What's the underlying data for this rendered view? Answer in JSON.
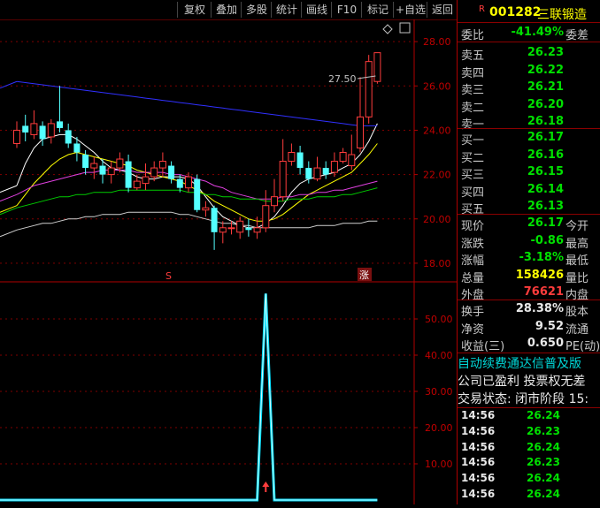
{
  "toolbar": {
    "buttons": [
      "复权",
      "叠加",
      "多股",
      "统计",
      "画线",
      "F10",
      "标记",
      "+自选",
      "返回"
    ]
  },
  "main_chart": {
    "y_ticks": [
      "28.00",
      "26.00",
      "24.00",
      "22.00",
      "20.00",
      "18.00"
    ],
    "high_label": "27.50",
    "marker_left": "S",
    "marker_right": "涨",
    "settings_icon": "diamond-icon"
  },
  "sub_chart": {
    "y_ticks": [
      "50.00",
      "40.00",
      "30.00",
      "20.00",
      "10.00"
    ]
  },
  "chart_data": {
    "type": "line",
    "candles": [
      [
        23.4,
        24.0,
        24.4,
        23.2
      ],
      [
        24.2,
        23.9,
        24.7,
        23.5
      ],
      [
        23.8,
        24.3,
        24.9,
        23.6
      ],
      [
        24.2,
        23.6,
        24.4,
        23.3
      ],
      [
        23.7,
        24.3,
        24.5,
        23.4
      ],
      [
        24.4,
        24.1,
        26.0,
        23.9
      ],
      [
        24.0,
        23.4,
        24.3,
        23.2
      ],
      [
        23.4,
        23.0,
        23.7,
        22.6
      ],
      [
        22.9,
        22.3,
        23.1,
        22.0
      ],
      [
        22.3,
        22.5,
        22.8,
        21.8
      ],
      [
        22.4,
        22.0,
        22.7,
        21.6
      ],
      [
        22.0,
        22.3,
        22.6,
        21.6
      ],
      [
        22.3,
        22.7,
        23.0,
        22.1
      ],
      [
        22.6,
        21.4,
        22.9,
        21.2
      ],
      [
        21.4,
        21.7,
        22.0,
        21.3
      ],
      [
        21.6,
        21.9,
        22.5,
        21.3
      ],
      [
        21.9,
        22.3,
        22.6,
        21.7
      ],
      [
        22.3,
        22.6,
        23.0,
        21.9
      ],
      [
        22.4,
        21.8,
        22.6,
        21.6
      ],
      [
        21.8,
        21.4,
        22.0,
        21.2
      ],
      [
        21.4,
        21.9,
        22.1,
        21.2
      ],
      [
        21.8,
        20.4,
        22.0,
        20.3
      ],
      [
        20.4,
        20.5,
        20.8,
        20.1
      ],
      [
        20.5,
        19.4,
        20.6,
        18.6
      ],
      [
        19.4,
        19.6,
        19.9,
        18.9
      ],
      [
        19.6,
        19.6,
        19.9,
        19.3
      ],
      [
        19.4,
        19.9,
        20.1,
        19.1
      ],
      [
        19.6,
        19.5,
        20.0,
        19.2
      ],
      [
        19.4,
        19.6,
        20.1,
        19.1
      ],
      [
        19.6,
        20.6,
        21.3,
        19.4
      ],
      [
        20.6,
        21.0,
        21.8,
        20.3
      ],
      [
        21.0,
        22.6,
        23.6,
        20.8
      ],
      [
        22.6,
        23.0,
        23.4,
        22.4
      ],
      [
        23.0,
        22.3,
        23.3,
        22.0
      ],
      [
        22.3,
        21.8,
        22.6,
        21.6
      ],
      [
        21.8,
        22.3,
        22.8,
        21.7
      ],
      [
        22.3,
        22.0,
        22.6,
        21.8
      ],
      [
        22.1,
        22.6,
        23.0,
        21.9
      ],
      [
        22.6,
        23.0,
        23.2,
        22.5
      ],
      [
        22.4,
        22.9,
        23.8,
        22.2
      ],
      [
        23.2,
        24.6,
        26.4,
        23.0
      ],
      [
        24.6,
        27.1,
        27.4,
        24.3
      ],
      [
        26.2,
        27.5,
        27.5,
        26.1
      ]
    ],
    "ma_series": [
      {
        "name": "",
        "color": "#ffffff",
        "values": [
          21.5,
          22.5,
          23.2,
          23.6,
          23.7,
          23.8,
          23.8,
          23.6,
          23.3,
          23.0,
          22.6,
          22.3,
          22.2,
          22.1,
          21.9,
          21.8,
          21.8,
          21.9,
          21.9,
          21.9,
          21.8,
          21.5,
          21.0,
          20.5,
          20.1,
          19.9,
          19.7,
          19.6,
          19.6,
          19.8,
          20.1,
          20.6,
          21.2,
          21.6,
          21.8,
          21.9,
          22.0,
          22.1,
          22.3,
          22.5,
          22.9,
          23.5,
          24.3
        ]
      },
      {
        "name": "",
        "color": "#ffff00",
        "values": [
          20.6,
          21.1,
          21.6,
          22.0,
          22.4,
          22.7,
          22.9,
          23.0,
          22.9,
          22.8,
          22.7,
          22.6,
          22.5,
          22.4,
          22.2,
          22.1,
          22.0,
          21.9,
          21.8,
          21.7,
          21.5,
          21.3,
          21.1,
          20.8,
          20.6,
          20.4,
          20.2,
          20.0,
          19.9,
          19.9,
          20.0,
          20.2,
          20.5,
          20.8,
          21.1,
          21.3,
          21.5,
          21.7,
          21.9,
          22.1,
          22.5,
          22.9,
          23.4
        ]
      },
      {
        "name": "",
        "color": "#e040e0",
        "values": [
          21.1,
          21.3,
          21.5,
          21.6,
          21.7,
          21.8,
          21.9,
          22.0,
          22.1,
          22.1,
          22.2,
          22.2,
          22.2,
          22.2,
          22.1,
          22.1,
          22.1,
          22.1,
          22.0,
          22.0,
          21.9,
          21.8,
          21.7,
          21.5,
          21.4,
          21.2,
          21.1,
          21.0,
          20.9,
          20.9,
          20.9,
          21.0,
          21.0,
          21.1,
          21.1,
          21.2,
          21.2,
          21.3,
          21.3,
          21.4,
          21.5,
          21.6,
          21.7
        ]
      },
      {
        "name": "",
        "color": "#00cc00",
        "values": [
          20.5,
          20.6,
          20.7,
          20.8,
          20.9,
          21.0,
          21.0,
          21.1,
          21.1,
          21.2,
          21.2,
          21.2,
          21.3,
          21.3,
          21.3,
          21.3,
          21.3,
          21.3,
          21.3,
          21.3,
          21.2,
          21.2,
          21.1,
          21.1,
          21.0,
          21.0,
          20.9,
          20.9,
          20.9,
          20.8,
          20.8,
          20.8,
          20.9,
          20.9,
          20.9,
          21.0,
          21.0,
          21.0,
          21.1,
          21.1,
          21.2,
          21.3,
          21.4
        ]
      },
      {
        "name": "",
        "color": "#d0d0d0",
        "values": [
          19.5,
          19.6,
          19.7,
          19.8,
          19.8,
          19.9,
          20.0,
          20.0,
          20.1,
          20.1,
          20.2,
          20.2,
          20.2,
          20.3,
          20.3,
          20.3,
          20.3,
          20.3,
          20.3,
          20.2,
          20.2,
          20.1,
          20.0,
          19.9,
          19.8,
          19.8,
          19.7,
          19.7,
          19.6,
          19.6,
          19.6,
          19.6,
          19.6,
          19.6,
          19.6,
          19.7,
          19.7,
          19.7,
          19.8,
          19.8,
          19.8,
          19.9,
          19.9
        ]
      },
      {
        "name": "",
        "color": "#3030ff",
        "values": [
          26.2,
          26.15,
          26.1,
          26.05,
          26.0,
          25.95,
          25.9,
          25.85,
          25.8,
          25.75,
          25.7,
          25.65,
          25.6,
          25.55,
          25.5,
          25.45,
          25.4,
          25.35,
          25.3,
          25.25,
          25.2,
          25.15,
          25.1,
          25.05,
          25.0,
          24.95,
          24.9,
          24.85,
          24.8,
          24.75,
          24.7,
          24.65,
          24.6,
          24.55,
          24.5,
          24.45,
          24.4,
          24.35,
          24.3,
          24.25,
          24.2,
          24.2,
          24.2
        ]
      }
    ],
    "sub_values": [
      0,
      0,
      0,
      0,
      0,
      0,
      0,
      0,
      0,
      0,
      0,
      0,
      0,
      0,
      0,
      0,
      0,
      0,
      0,
      0,
      0,
      0,
      0,
      0,
      0,
      0,
      0,
      0,
      0,
      57,
      0,
      0,
      0,
      0,
      0,
      0,
      0,
      0,
      0,
      0,
      0,
      0,
      0
    ],
    "main_ylim": [
      17.2,
      29.0
    ],
    "sub_ylim": [
      0,
      60
    ]
  },
  "panel": {
    "badge": "R",
    "code": "001282",
    "name": "三联锻造",
    "weibi_label": "委比",
    "weibi_value": "-41.49%",
    "weicha_label": "委差",
    "asks": [
      {
        "label": "卖五",
        "price": "26.23"
      },
      {
        "label": "卖四",
        "price": "26.22"
      },
      {
        "label": "卖三",
        "price": "26.21"
      },
      {
        "label": "卖二",
        "price": "26.20"
      },
      {
        "label": "卖一",
        "price": "26.18"
      }
    ],
    "bids": [
      {
        "label": "买一",
        "price": "26.17"
      },
      {
        "label": "买二",
        "price": "26.16"
      },
      {
        "label": "买三",
        "price": "26.15"
      },
      {
        "label": "买四",
        "price": "26.14"
      },
      {
        "label": "买五",
        "price": "26.13"
      }
    ],
    "quote": [
      {
        "label": "现价",
        "value": "26.17",
        "label2": "今开",
        "color": "green"
      },
      {
        "label": "涨跌",
        "value": "-0.86",
        "label2": "最高",
        "color": "green"
      },
      {
        "label": "涨幅",
        "value": "-3.18%",
        "label2": "最低",
        "color": "green"
      },
      {
        "label": "总量",
        "value": "158426",
        "label2": "量比",
        "color": "yellow"
      },
      {
        "label": "外盘",
        "value": "76621",
        "label2": "内盘",
        "color": "red"
      }
    ],
    "fin": [
      {
        "label": "换手",
        "value": "28.38%",
        "label2": "股本"
      },
      {
        "label": "净资",
        "value": "9.52",
        "label2": "流通"
      },
      {
        "label": "收益(三)",
        "value": "0.650",
        "label2": "PE(动)"
      }
    ],
    "notice1": "自动续费通达信普及版",
    "notice2": "公司已盈利 投票权无差",
    "status": "交易状态: 闭市阶段 15:",
    "trades": [
      {
        "time": "14:56",
        "price": "26.24"
      },
      {
        "time": "14:56",
        "price": "26.23"
      },
      {
        "time": "14:56",
        "price": "26.24"
      },
      {
        "time": "14:56",
        "price": "26.23"
      },
      {
        "time": "14:56",
        "price": "26.24"
      },
      {
        "time": "14:56",
        "price": "26.24"
      }
    ]
  }
}
